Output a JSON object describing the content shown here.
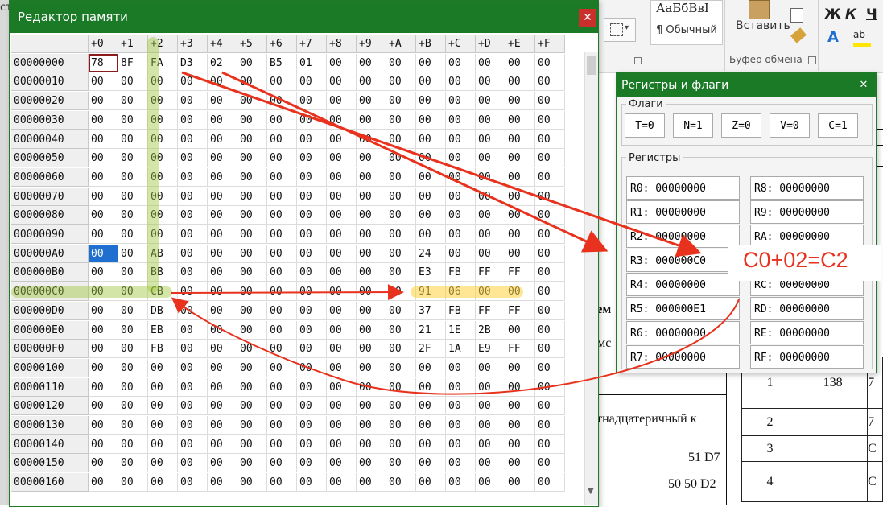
{
  "background_app": {
    "style_sample": "АаБбВвІ",
    "style_name": "¶ Обычный",
    "paste_label": "Вставить",
    "clipboard_group": "Буфер обмена",
    "font_buttons": [
      "Ж",
      "К",
      "Ч"
    ],
    "left_edge_text": "ст",
    "doc_texts": [
      "нем",
      "емс",
      "стнадцатеричный к",
      "51 D7",
      "50 50 D2"
    ],
    "table_rows": [
      [
        "1",
        "138",
        "7"
      ],
      [
        "2",
        "",
        "7"
      ],
      [
        "3",
        "",
        "С"
      ],
      [
        "4",
        "",
        "С"
      ]
    ],
    "colors": {
      "highlight": "#ffe600",
      "font_color": "#1e6fd0"
    }
  },
  "memory_editor": {
    "title": "Редактор памяти",
    "close_icon": "close-icon",
    "column_headers": [
      "+0",
      "+1",
      "+2",
      "+3",
      "+4",
      "+5",
      "+6",
      "+7",
      "+8",
      "+9",
      "+A",
      "+B",
      "+C",
      "+D",
      "+E",
      "+F"
    ],
    "rows": [
      {
        "addr": "00000000",
        "cells": [
          "78",
          "8F",
          "FA",
          "D3",
          "02",
          "00",
          "B5",
          "01",
          "00",
          "00",
          "00",
          "00",
          "00",
          "00",
          "00",
          "00"
        ]
      },
      {
        "addr": "00000010",
        "cells": [
          "00",
          "00",
          "00",
          "00",
          "00",
          "00",
          "00",
          "00",
          "00",
          "00",
          "00",
          "00",
          "00",
          "00",
          "00",
          "00"
        ]
      },
      {
        "addr": "00000020",
        "cells": [
          "00",
          "00",
          "00",
          "00",
          "00",
          "00",
          "00",
          "00",
          "00",
          "00",
          "00",
          "00",
          "00",
          "00",
          "00",
          "00"
        ]
      },
      {
        "addr": "00000030",
        "cells": [
          "00",
          "00",
          "00",
          "00",
          "00",
          "00",
          "00",
          "00",
          "00",
          "00",
          "00",
          "00",
          "00",
          "00",
          "00",
          "00"
        ]
      },
      {
        "addr": "00000040",
        "cells": [
          "00",
          "00",
          "00",
          "00",
          "00",
          "00",
          "00",
          "00",
          "00",
          "00",
          "00",
          "00",
          "00",
          "00",
          "00",
          "00"
        ]
      },
      {
        "addr": "00000050",
        "cells": [
          "00",
          "00",
          "00",
          "00",
          "00",
          "00",
          "00",
          "00",
          "00",
          "00",
          "00",
          "00",
          "00",
          "00",
          "00",
          "00"
        ]
      },
      {
        "addr": "00000060",
        "cells": [
          "00",
          "00",
          "00",
          "00",
          "00",
          "00",
          "00",
          "00",
          "00",
          "00",
          "00",
          "00",
          "00",
          "00",
          "00",
          "00"
        ]
      },
      {
        "addr": "00000070",
        "cells": [
          "00",
          "00",
          "00",
          "00",
          "00",
          "00",
          "00",
          "00",
          "00",
          "00",
          "00",
          "00",
          "00",
          "00",
          "00",
          "00"
        ]
      },
      {
        "addr": "00000080",
        "cells": [
          "00",
          "00",
          "00",
          "00",
          "00",
          "00",
          "00",
          "00",
          "00",
          "00",
          "00",
          "00",
          "00",
          "00",
          "00",
          "00"
        ]
      },
      {
        "addr": "00000090",
        "cells": [
          "00",
          "00",
          "00",
          "00",
          "00",
          "00",
          "00",
          "00",
          "00",
          "00",
          "00",
          "00",
          "00",
          "00",
          "00",
          "00"
        ]
      },
      {
        "addr": "000000A0",
        "cells": [
          "00",
          "00",
          "AB",
          "00",
          "00",
          "00",
          "00",
          "00",
          "00",
          "00",
          "00",
          "24",
          "00",
          "00",
          "00",
          "00"
        ]
      },
      {
        "addr": "000000B0",
        "cells": [
          "00",
          "00",
          "BB",
          "00",
          "00",
          "00",
          "00",
          "00",
          "00",
          "00",
          "00",
          "E3",
          "FB",
          "FF",
          "FF",
          "00"
        ]
      },
      {
        "addr": "000000C0",
        "cells": [
          "00",
          "00",
          "CB",
          "00",
          "00",
          "00",
          "00",
          "00",
          "00",
          "00",
          "00",
          "91",
          "06",
          "00",
          "00",
          "00"
        ]
      },
      {
        "addr": "000000D0",
        "cells": [
          "00",
          "00",
          "DB",
          "00",
          "00",
          "00",
          "00",
          "00",
          "00",
          "00",
          "00",
          "37",
          "FB",
          "FF",
          "FF",
          "00"
        ]
      },
      {
        "addr": "000000E0",
        "cells": [
          "00",
          "00",
          "EB",
          "00",
          "00",
          "00",
          "00",
          "00",
          "00",
          "00",
          "00",
          "21",
          "1E",
          "2B",
          "00",
          "00"
        ]
      },
      {
        "addr": "000000F0",
        "cells": [
          "00",
          "00",
          "FB",
          "00",
          "00",
          "00",
          "00",
          "00",
          "00",
          "00",
          "00",
          "2F",
          "1A",
          "E9",
          "FF",
          "00"
        ]
      },
      {
        "addr": "00000100",
        "cells": [
          "00",
          "00",
          "00",
          "00",
          "00",
          "00",
          "00",
          "00",
          "00",
          "00",
          "00",
          "00",
          "00",
          "00",
          "00",
          "00"
        ]
      },
      {
        "addr": "00000110",
        "cells": [
          "00",
          "00",
          "00",
          "00",
          "00",
          "00",
          "00",
          "00",
          "00",
          "00",
          "00",
          "00",
          "00",
          "00",
          "00",
          "00"
        ]
      },
      {
        "addr": "00000120",
        "cells": [
          "00",
          "00",
          "00",
          "00",
          "00",
          "00",
          "00",
          "00",
          "00",
          "00",
          "00",
          "00",
          "00",
          "00",
          "00",
          "00"
        ]
      },
      {
        "addr": "00000130",
        "cells": [
          "00",
          "00",
          "00",
          "00",
          "00",
          "00",
          "00",
          "00",
          "00",
          "00",
          "00",
          "00",
          "00",
          "00",
          "00",
          "00"
        ]
      },
      {
        "addr": "00000140",
        "cells": [
          "00",
          "00",
          "00",
          "00",
          "00",
          "00",
          "00",
          "00",
          "00",
          "00",
          "00",
          "00",
          "00",
          "00",
          "00",
          "00"
        ]
      },
      {
        "addr": "00000150",
        "cells": [
          "00",
          "00",
          "00",
          "00",
          "00",
          "00",
          "00",
          "00",
          "00",
          "00",
          "00",
          "00",
          "00",
          "00",
          "00",
          "00"
        ]
      },
      {
        "addr": "00000160",
        "cells": [
          "00",
          "00",
          "00",
          "00",
          "00",
          "00",
          "00",
          "00",
          "00",
          "00",
          "00",
          "00",
          "00",
          "00",
          "00",
          "00"
        ]
      }
    ]
  },
  "registers_window": {
    "title": "Регистры и флаги",
    "close_icon": "close-icon",
    "flags_label": "Флаги",
    "flags": [
      "T=0",
      "N=1",
      "Z=0",
      "V=0",
      "C=1"
    ],
    "registers_label": "Регистры",
    "registers_left": [
      "R0: 00000000",
      "R1: 00000000",
      "R2: 00000000",
      "R3: 000000C0",
      "R4: 00000000",
      "R5: 000000E1",
      "R6: 00000000",
      "R7: 00000000"
    ],
    "registers_right": [
      "R8: 00000000",
      "R9: 00000000",
      "RA: 00000000",
      "RB: 00000000",
      "RC: 00000000",
      "RD: 00000000",
      "RE: 00000000",
      "RF: 00000000"
    ]
  },
  "annotation": {
    "text": "C0+02=C2",
    "color": "#e8321e"
  }
}
